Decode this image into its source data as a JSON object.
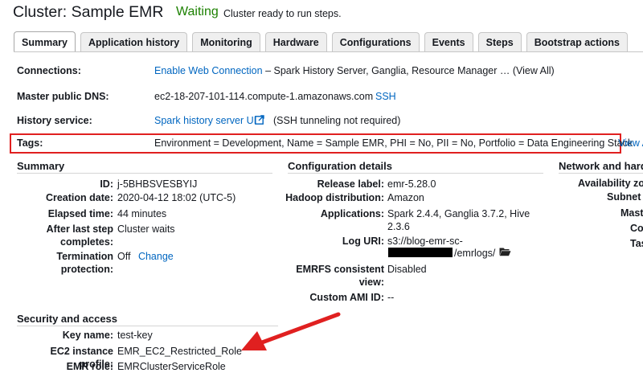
{
  "header": {
    "title": "Cluster: Sample EMR",
    "status": "Waiting",
    "status_detail": "Cluster ready to run steps.",
    "status_color": "#1d8102"
  },
  "tabs": [
    {
      "label": "Summary",
      "active": true
    },
    {
      "label": "Application history"
    },
    {
      "label": "Monitoring"
    },
    {
      "label": "Hardware"
    },
    {
      "label": "Configurations"
    },
    {
      "label": "Events"
    },
    {
      "label": "Steps"
    },
    {
      "label": "Bootstrap actions"
    }
  ],
  "overview": {
    "connections_label": "Connections:",
    "connections_link": "Enable Web Connection",
    "connections_text": "– Spark History Server, Ganglia, Resource Manager … (View All)",
    "dns_label": "Master public DNS:",
    "dns_value": "ec2-18-207-101-114.compute-1.amazonaws.com",
    "dns_ssh": "SSH",
    "history_label": "History service:",
    "history_link": "Spark history server UI",
    "history_note": "(SSH tunneling not required)",
    "tags_label": "Tags:",
    "tags_value": "Environment = Development, Name = Sample EMR, PHI = No, PII = No, Portfolio = Data Engineering Stack",
    "tags_view": "View A",
    "highlight_color": "#e02020"
  },
  "summary": {
    "title": "Summary",
    "id_label": "ID:",
    "id_value": "j-5BHBSVESBYIJ",
    "created_label": "Creation date:",
    "created_value": "2020-04-12 18:02 (UTC-5)",
    "elapsed_label": "Elapsed time:",
    "elapsed_value": "44 minutes",
    "after_label_1": "After last step",
    "after_label_2": "completes:",
    "after_value": "Cluster waits",
    "term_label_1": "Termination",
    "term_label_2": "protection:",
    "term_value": "Off",
    "term_change": "Change"
  },
  "config": {
    "title": "Configuration details",
    "release_label": "Release label:",
    "release_value": "emr-5.28.0",
    "hadoop_label": "Hadoop distribution:",
    "hadoop_value": "Amazon",
    "apps_label": "Applications:",
    "apps_value_1": "Spark 2.4.4, Ganglia 3.7.2, Hive",
    "apps_value_2": "2.3.6",
    "log_label": "Log URI:",
    "log_value_1": "s3://blog-emr-sc-",
    "log_value_2": "/emrlogs/",
    "emrfs_label_1": "EMRFS consistent",
    "emrfs_label_2": "view:",
    "emrfs_value": "Disabled",
    "ami_label": "Custom AMI ID:",
    "ami_value": "--"
  },
  "network": {
    "title": "Network and hard",
    "l1": "Availability zon",
    "l2": "Subnet I",
    "l3": "Mast",
    "l4": "Co",
    "l5": "Tas"
  },
  "security": {
    "title": "Security and access",
    "key_label": "Key name:",
    "key_value": "test-key",
    "profile_label": "EC2 instance profile:",
    "profile_value": "EMR_EC2_Restricted_Role",
    "role_label": "EMR role:",
    "role_value": "EMRClusterServiceRole"
  },
  "icons": {
    "external_link": "external-link-icon",
    "folder": "folder-icon",
    "arrow": "red-arrow-annotation"
  }
}
